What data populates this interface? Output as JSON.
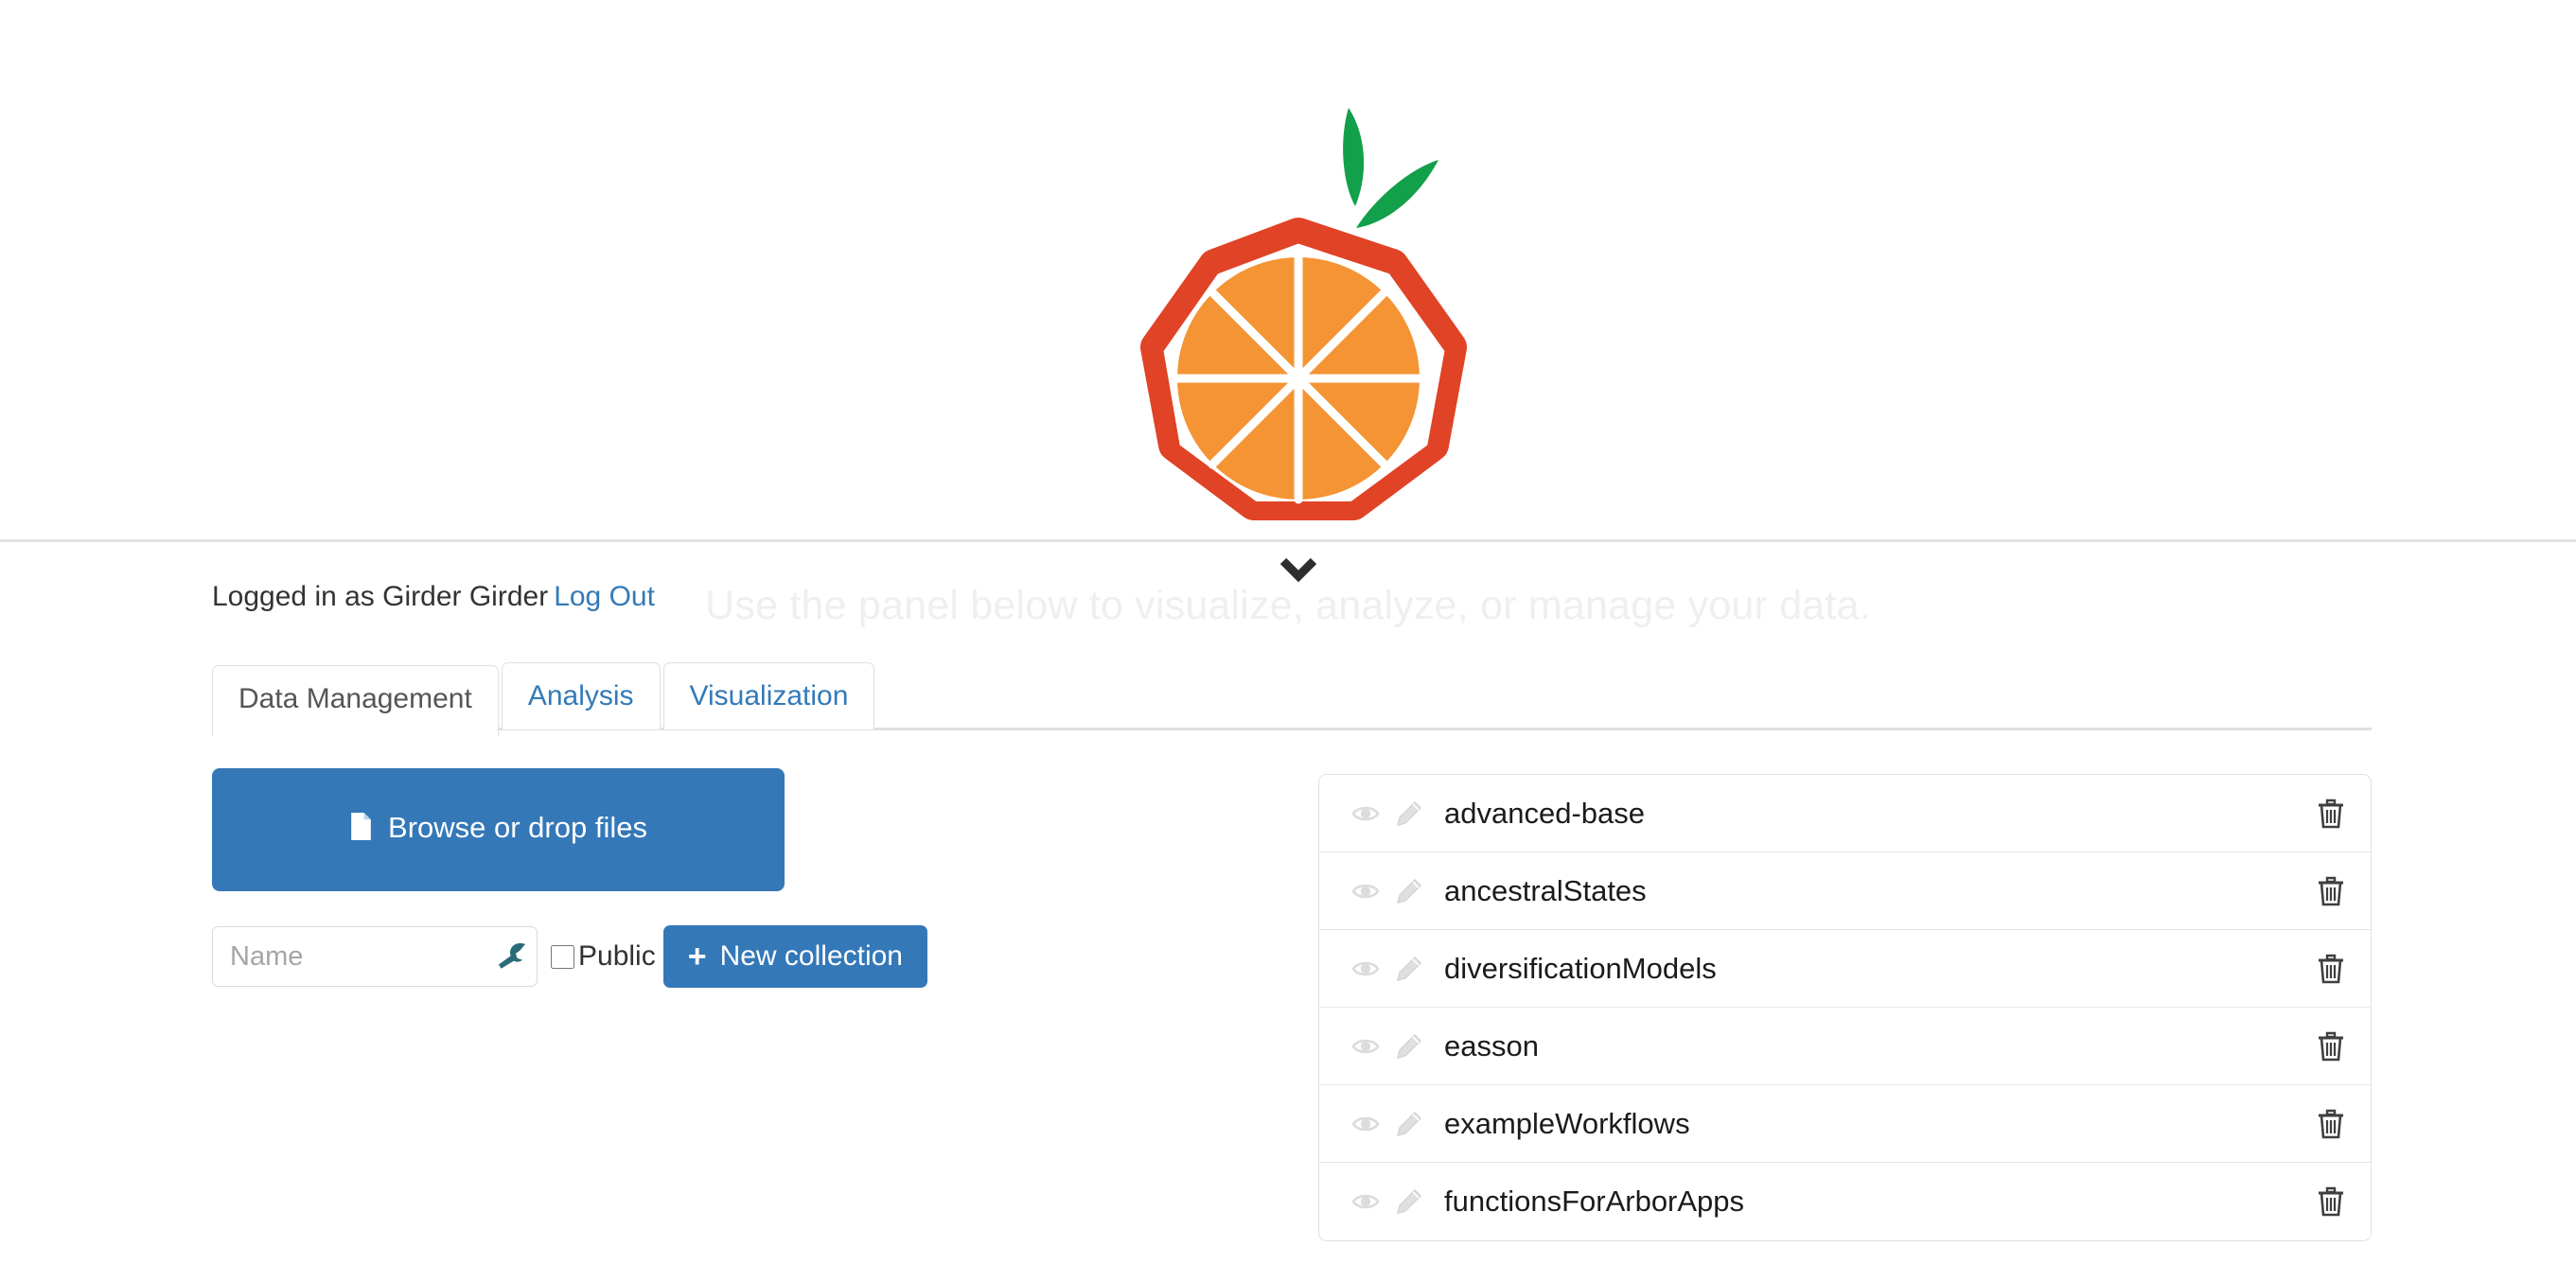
{
  "hero": {
    "logo_name": "arbor-orange-logo",
    "logo_colors": {
      "frame_red": "#e04325",
      "slice_orange": "#f59434",
      "leaf_green": "#12a04a"
    },
    "subtitle": "Use the panel below to visualize, analyze, or manage your data.",
    "chevron_icon": "chevron-down-icon"
  },
  "session": {
    "logged_in_text": "Logged in as Girder Girder",
    "logout_label": "Log Out"
  },
  "tabs": [
    {
      "label": "Data Management",
      "active": true
    },
    {
      "label": "Analysis",
      "active": false
    },
    {
      "label": "Visualization",
      "active": false
    }
  ],
  "left_panel": {
    "browse_button": {
      "label": "Browse or drop files",
      "icon": "file-icon",
      "color": "#3478b8"
    },
    "name_input": {
      "value": "",
      "placeholder": "Name",
      "icon": "wrench-icon"
    },
    "public_checkbox": {
      "label": "Public",
      "checked": false
    },
    "new_collection_button": {
      "label": "New collection",
      "icon": "plus-icon",
      "color": "#3478b8"
    }
  },
  "collections": {
    "row_icons": [
      "eye-icon",
      "pencil-icon",
      "trash-icon"
    ],
    "items": [
      {
        "name": "advanced-base"
      },
      {
        "name": "ancestralStates"
      },
      {
        "name": "diversificationModels"
      },
      {
        "name": "easson"
      },
      {
        "name": "exampleWorkflows"
      },
      {
        "name": "functionsForArborApps"
      }
    ]
  },
  "colors": {
    "accent_blue": "#3478b8",
    "link_blue": "#337ab7",
    "border_gray": "#e0e0e0",
    "text_dark": "#1b1b1b",
    "faded_text": "#efefef"
  }
}
